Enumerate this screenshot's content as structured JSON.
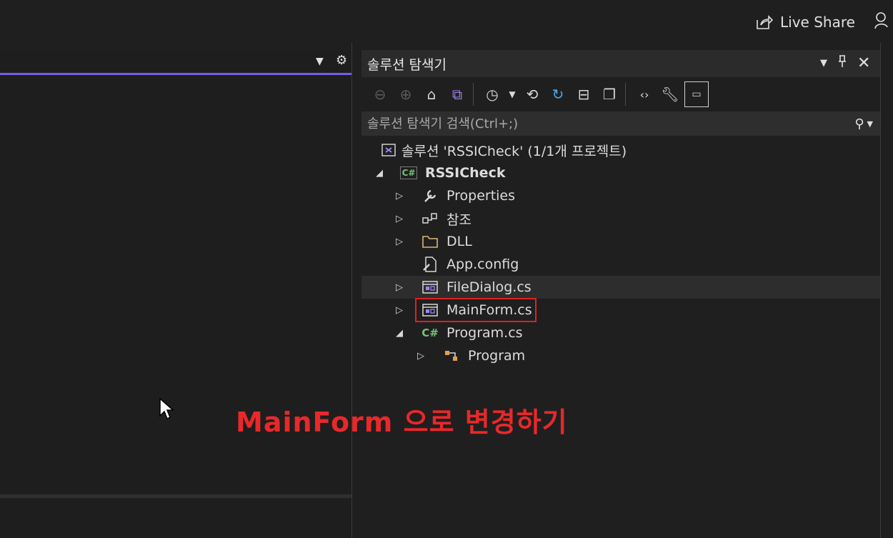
{
  "header": {
    "live_share_label": "Live Share"
  },
  "solution_explorer": {
    "title": "솔루션 탐색기",
    "search_placeholder": "솔루션 탐색기 검색(Ctrl+;)",
    "tree": [
      {
        "label": "솔루션 'RSSICheck' (1/1개 프로젝트)",
        "icon": "solution-icon"
      },
      {
        "label": "RSSICheck",
        "icon": "csharp-project-icon"
      },
      {
        "label": "Properties",
        "icon": "wrench-icon"
      },
      {
        "label": "참조",
        "icon": "references-icon"
      },
      {
        "label": "DLL",
        "icon": "folder-icon"
      },
      {
        "label": "App.config",
        "icon": "config-icon"
      },
      {
        "label": "FileDialog.cs",
        "icon": "form-icon"
      },
      {
        "label": "MainForm.cs",
        "icon": "form-icon"
      },
      {
        "label": "Program.cs",
        "icon": "csharp-file-icon"
      },
      {
        "label": "Program",
        "icon": "class-icon"
      }
    ]
  },
  "annotation": {
    "text": "MainForm 으로 변경하기",
    "color": "#e8282a"
  },
  "colors": {
    "accent": "#7160e8",
    "highlight": "#e02020"
  }
}
